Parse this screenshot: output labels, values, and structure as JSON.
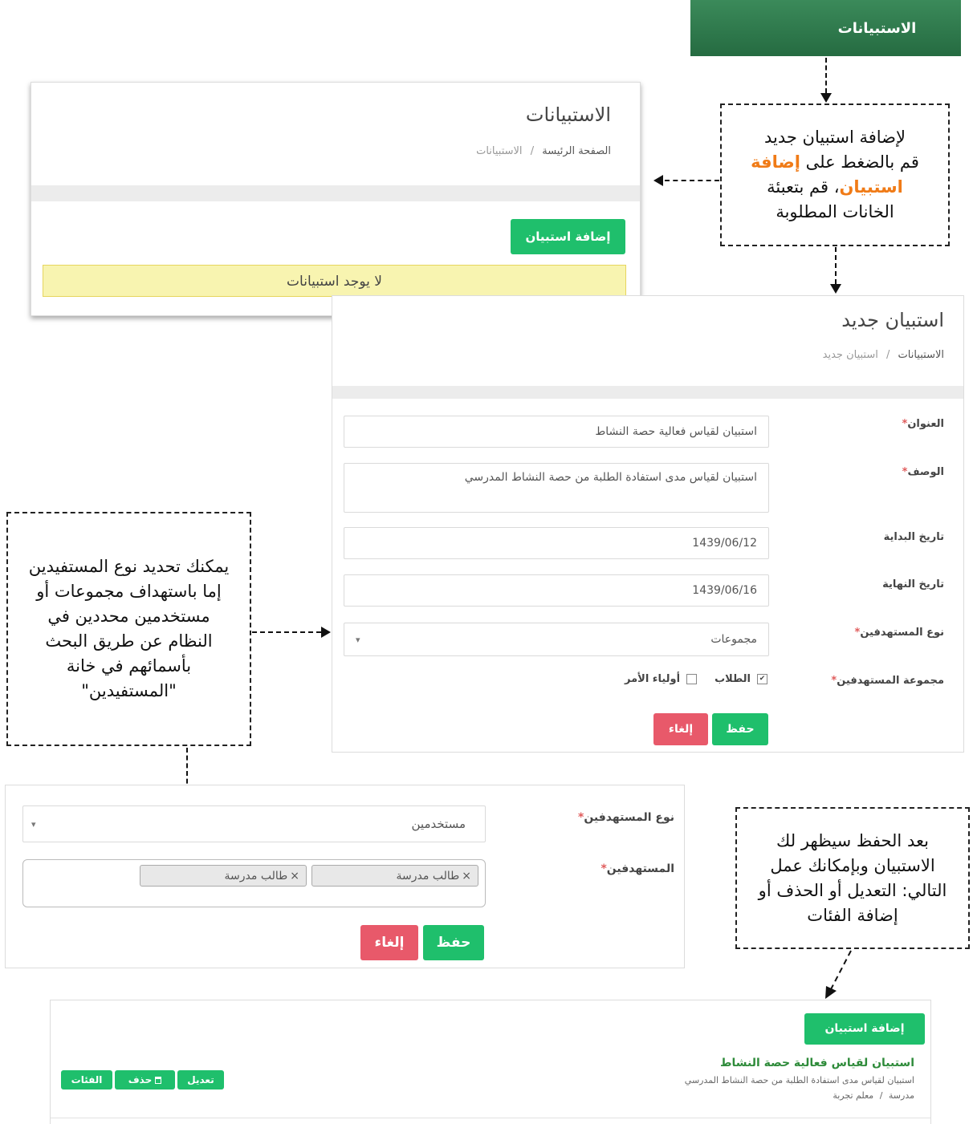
{
  "header_tab": {
    "label": "الاستبيانات",
    "bg": "#2f7d4f"
  },
  "list_page": {
    "title": "الاستبيانات",
    "breadcrumb": [
      "الصفحة الرئيسة",
      "الاستبيانات"
    ],
    "add_button": "إضافة استبيان",
    "empty_message": "لا يوجد استبيانات"
  },
  "callouts": {
    "add_line1": "لإضافة استبيان جديد",
    "add_line2a": "قم بالضغط على ",
    "add_line2b": "إضافة",
    "add_line3a": "استبيان",
    "add_line3b": "، قم بتعبئة",
    "add_line4": "الخانات المطلوبة",
    "target_text": "يمكنك تحديد نوع المستفيدين إما باستهداف مجموعات أو مستخدمين محددين في النظام عن طريق البحث بأسمائهم في خانة \"المستفيدين\"",
    "after_save_text": "بعد الحفظ سيظهر لك الاستبيان وبإمكانك عمل التالي: التعديل أو الحذف أو إضافة الفئات"
  },
  "new_form": {
    "title": "استبيان جديد",
    "breadcrumb": [
      "الاستبيانات",
      "استبيان جديد"
    ],
    "fields": {
      "title_label": "العنوان",
      "title_value": "استبيان لقياس فعالية حصة النشاط",
      "desc_label": "الوصف",
      "desc_value": "استبيان لقياس مدى استفادة الطلبة من حصة النشاط المدرسي",
      "start_label": "تاريخ البداية",
      "start_value": "1439/06/12",
      "end_label": "تاريخ النهاية",
      "end_value": "1439/06/16",
      "type_label": "نوع المستهدفين",
      "type_value": "مجموعات",
      "group_label": "مجموعة المستهدفين",
      "group_students": "الطلاب",
      "group_parents": "أولياء الأمر"
    },
    "save_button": "حفظ",
    "cancel_button": "إلغاء"
  },
  "users_form": {
    "type_label": "نوع المستهدفين",
    "type_value": "مستخدمين",
    "targets_label": "المستهدفين",
    "chips": [
      "طالب مدرسة",
      "طالب مدرسة"
    ],
    "save_button": "حفظ",
    "cancel_button": "إلغاء"
  },
  "result": {
    "add_button": "إضافة استبيان",
    "survey_title": "استبيان لقياس فعالية حصة النشاط",
    "survey_desc": "استبيان لقياس مدى استفادة الطلبة من حصة النشاط المدرسي",
    "meta": [
      "مدرسة",
      "معلم تجربة"
    ],
    "edit_button": "تعديل",
    "delete_button": "حذف",
    "categories_button": "الفئات"
  },
  "required_mark": "*",
  "chip_remove": "×",
  "select_caret": "▾",
  "breadcrumb_sep": "/",
  "checkbox_checked": "✔",
  "colors": {
    "green": "#1fbf6c",
    "red": "#e8596a",
    "orange": "#f07b17",
    "title_green": "#2e8b3a",
    "empty_bg": "#f8f4b0"
  }
}
